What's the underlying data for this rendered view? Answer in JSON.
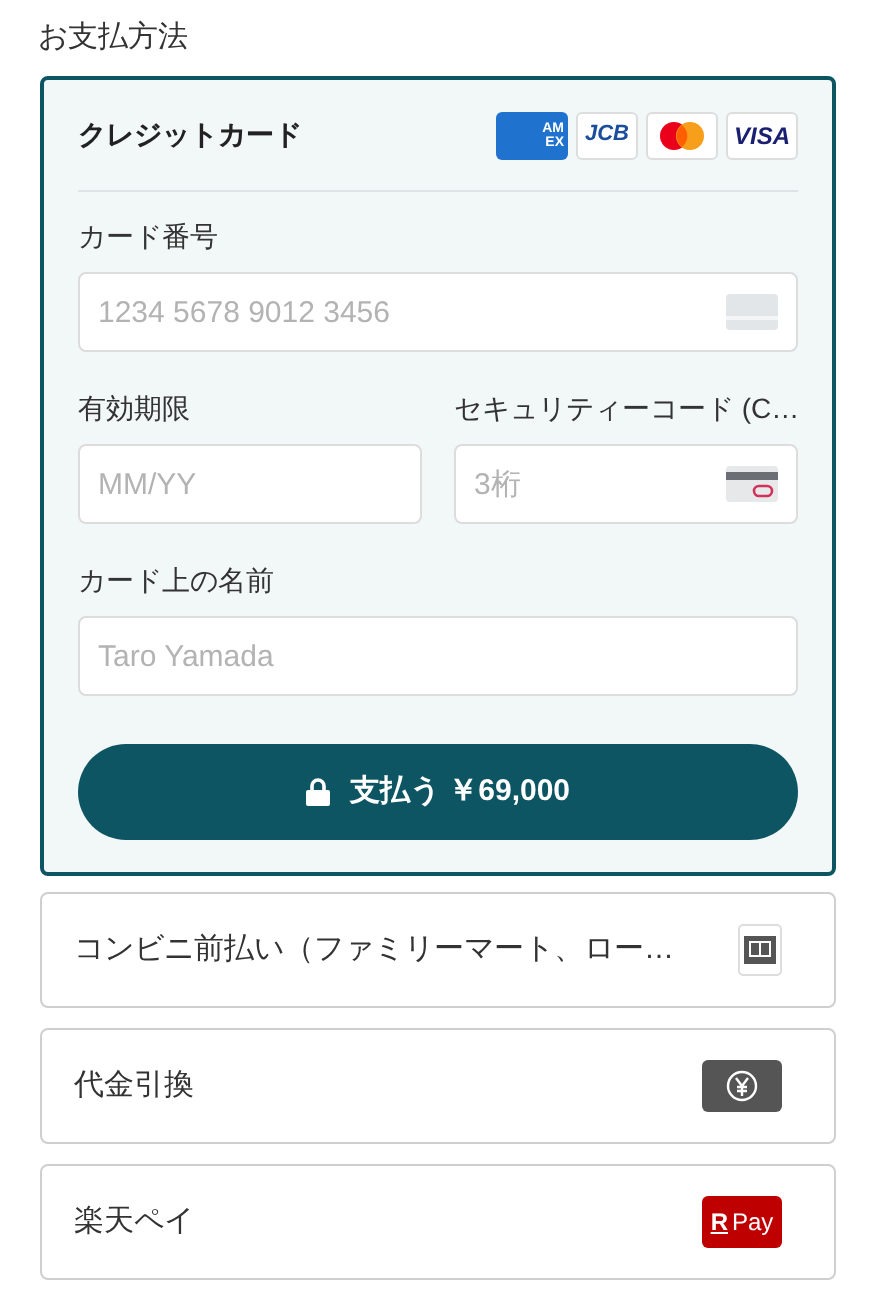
{
  "section_title": "お支払方法",
  "payment_methods": [
    {
      "label": "クレジットカード",
      "selected": true,
      "brands": [
        {
          "kind": "amex",
          "text": "AMEX"
        },
        {
          "kind": "jcb",
          "text": "JCB"
        },
        {
          "kind": "mastercard"
        },
        {
          "kind": "visa",
          "text": "VISA"
        }
      ],
      "card_number": {
        "label": "カード番号",
        "placeholder": "1234 5678 9012 3456"
      },
      "expiry": {
        "label": "有効期限",
        "placeholder": "MM/YY"
      },
      "security_code": {
        "label": "セキュリティーコード (C…",
        "placeholder": "3桁"
      },
      "card_name": {
        "label": "カード上の名前",
        "placeholder": "Taro Yamada"
      },
      "pay_button": "支払う ￥69,000"
    },
    {
      "label": "コンビニ前払い（ファミリーマート、ロー…",
      "selected": false,
      "kind": "store"
    },
    {
      "label": "代金引換",
      "selected": false,
      "kind": "yen"
    },
    {
      "label": "楽天ペイ",
      "selected": false,
      "kind": "rpay",
      "icon_text": "Pay",
      "icon_mark": "R"
    }
  ]
}
